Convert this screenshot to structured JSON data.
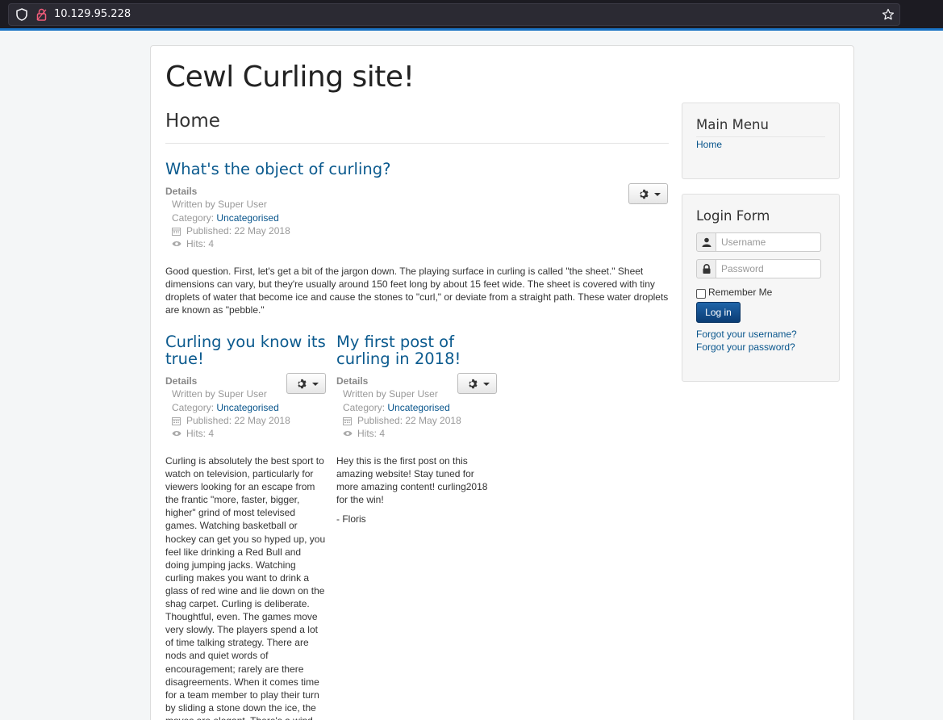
{
  "browser": {
    "url": "10.129.95.228"
  },
  "site": {
    "title": "Cewl Curling site!",
    "page_heading": "Home"
  },
  "labels": {
    "details": "Details"
  },
  "articles": [
    {
      "title": "What's the object of curling?",
      "written_by": "Written by Super User",
      "category_prefix": "Category:",
      "category": "Uncategorised",
      "published": "Published: 22 May 2018",
      "hits": "Hits: 4",
      "body": "Good question. First, let's get a bit of the jargon down. The playing surface in curling is called \"the sheet.\" Sheet dimensions can vary, but they're usually around 150 feet long by about 15 feet wide. The sheet is covered with tiny droplets of water that become ice and cause the stones to \"curl,\" or deviate from a straight path. These water droplets are known as \"pebble.\""
    },
    {
      "title": "Curling you know its true!",
      "written_by": "Written by Super User",
      "category_prefix": "Category:",
      "category": "Uncategorised",
      "published": "Published: 22 May 2018",
      "hits": "Hits: 4",
      "body": "Curling is absolutely the best sport to watch on television, particularly for viewers looking for an escape from the frantic \"more, faster, bigger, higher\" grind of most televised games. Watching basketball or hockey can get you so hyped up, you feel like drinking a Red Bull and doing jumping jacks. Watching curling makes you want to drink a glass of red wine and lie down on the shag carpet. Curling is deliberate. Thoughtful, even. The games move very slowly. The players spend a lot of time talking strategy. There are nods and quiet words of encouragement; rarely are there disagreements. When it comes time for a team member to play their turn by sliding a stone down the ice, the moves are elegant. There's a wind up, a push off, a slide, and a gentle"
    },
    {
      "title": "My first post of curling in 2018!",
      "written_by": "Written by Super User",
      "category_prefix": "Category:",
      "category": "Uncategorised",
      "published": "Published: 22 May 2018",
      "hits": "Hits: 4",
      "body": "Hey this is the first post on this amazing website! Stay tuned for more amazing content! curling2018 for the win!",
      "signature": "- Floris"
    }
  ],
  "sidebar": {
    "main_menu": {
      "title": "Main Menu",
      "items": [
        "Home"
      ]
    },
    "login_form": {
      "title": "Login Form",
      "username_placeholder": "Username",
      "password_placeholder": "Password",
      "remember_me": "Remember Me",
      "login_button": "Log in",
      "forgot_username": "Forgot your username?",
      "forgot_password": "Forgot your password?"
    }
  }
}
